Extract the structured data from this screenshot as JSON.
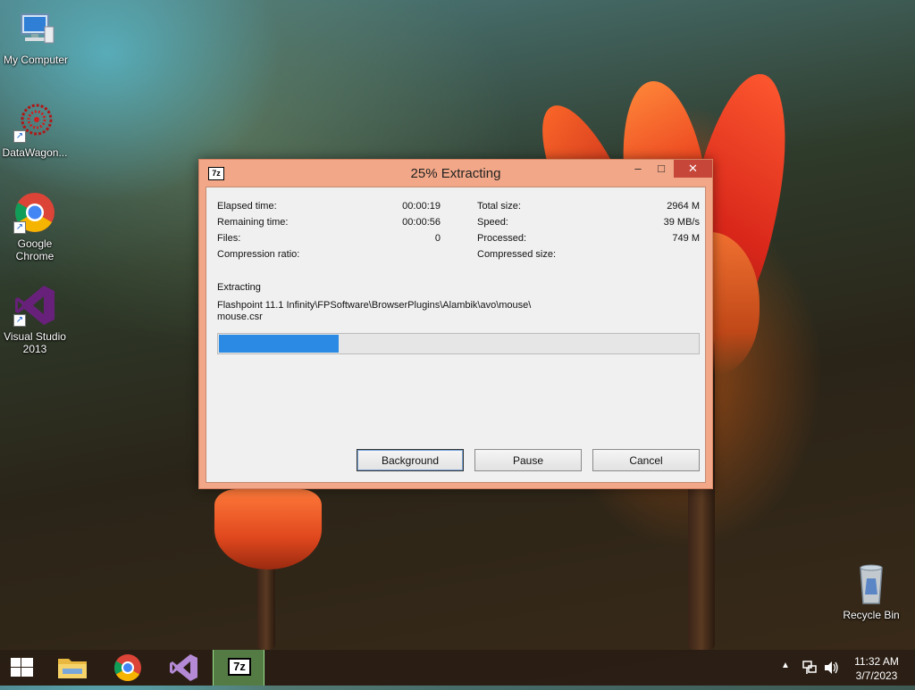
{
  "desktop": {
    "icons": [
      {
        "label": "My Computer"
      },
      {
        "label": "DataWagon..."
      },
      {
        "label": "Google Chrome"
      },
      {
        "label": "Visual Studio 2013"
      },
      {
        "label": "Recycle Bin"
      }
    ]
  },
  "dialog": {
    "title": "25% Extracting",
    "app_icon_text": "7z",
    "stats_left": [
      {
        "label": "Elapsed time:",
        "value": "00:00:19"
      },
      {
        "label": "Remaining time:",
        "value": "00:00:56"
      },
      {
        "label": "Files:",
        "value": "0"
      },
      {
        "label": "Compression ratio:",
        "value": ""
      }
    ],
    "stats_right": [
      {
        "label": "Total size:",
        "value": "2964 M"
      },
      {
        "label": "Speed:",
        "value": "39 MB/s"
      },
      {
        "label": "Processed:",
        "value": "749 M"
      },
      {
        "label": "Compressed size:",
        "value": ""
      }
    ],
    "operation_label": "Extracting",
    "current_path_line1": "Flashpoint 11.1 Infinity\\FPSoftware\\BrowserPlugins\\Alambik\\avo\\mouse\\",
    "current_path_line2": "mouse.csr",
    "progress_percent": 25,
    "buttons": {
      "background": "Background",
      "pause": "Pause",
      "cancel": "Cancel"
    },
    "colors": {
      "frame": "#f2a888",
      "close": "#c7463a",
      "progress": "#2b8ae4"
    }
  },
  "taskbar": {
    "active_item_text": "7z",
    "clock": {
      "time": "11:32 AM",
      "date": "3/7/2023"
    }
  }
}
